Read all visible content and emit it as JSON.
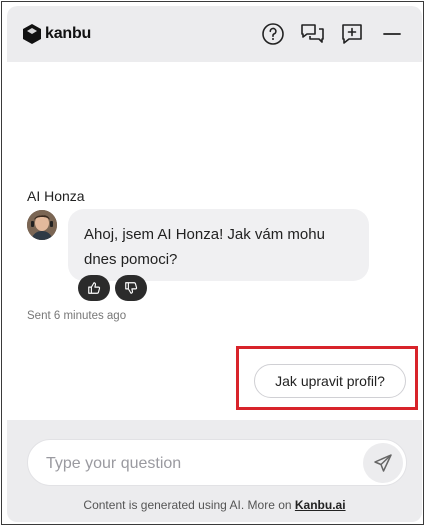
{
  "header": {
    "brand": "kanbu",
    "icons": [
      "help-icon",
      "conversations-icon",
      "new-chat-icon",
      "minimize-icon"
    ]
  },
  "chat": {
    "bot_name": "AI Honza",
    "message": "Ahoj, jsem AI Honza! Jak vám mohu dnes pomoci?",
    "sent_time": "Sent 6 minutes ago",
    "suggestion": "Jak upravit profil?"
  },
  "composer": {
    "placeholder": "Type your question"
  },
  "footer": {
    "disclaimer_prefix": "Content is generated using AI. More on ",
    "link_label": "Kanbu.ai"
  },
  "colors": {
    "header_bg": "#ececee",
    "bubble_bg": "#f0f0f2",
    "feedback_bg": "#2b2b2b",
    "highlight": "#d8232a"
  }
}
